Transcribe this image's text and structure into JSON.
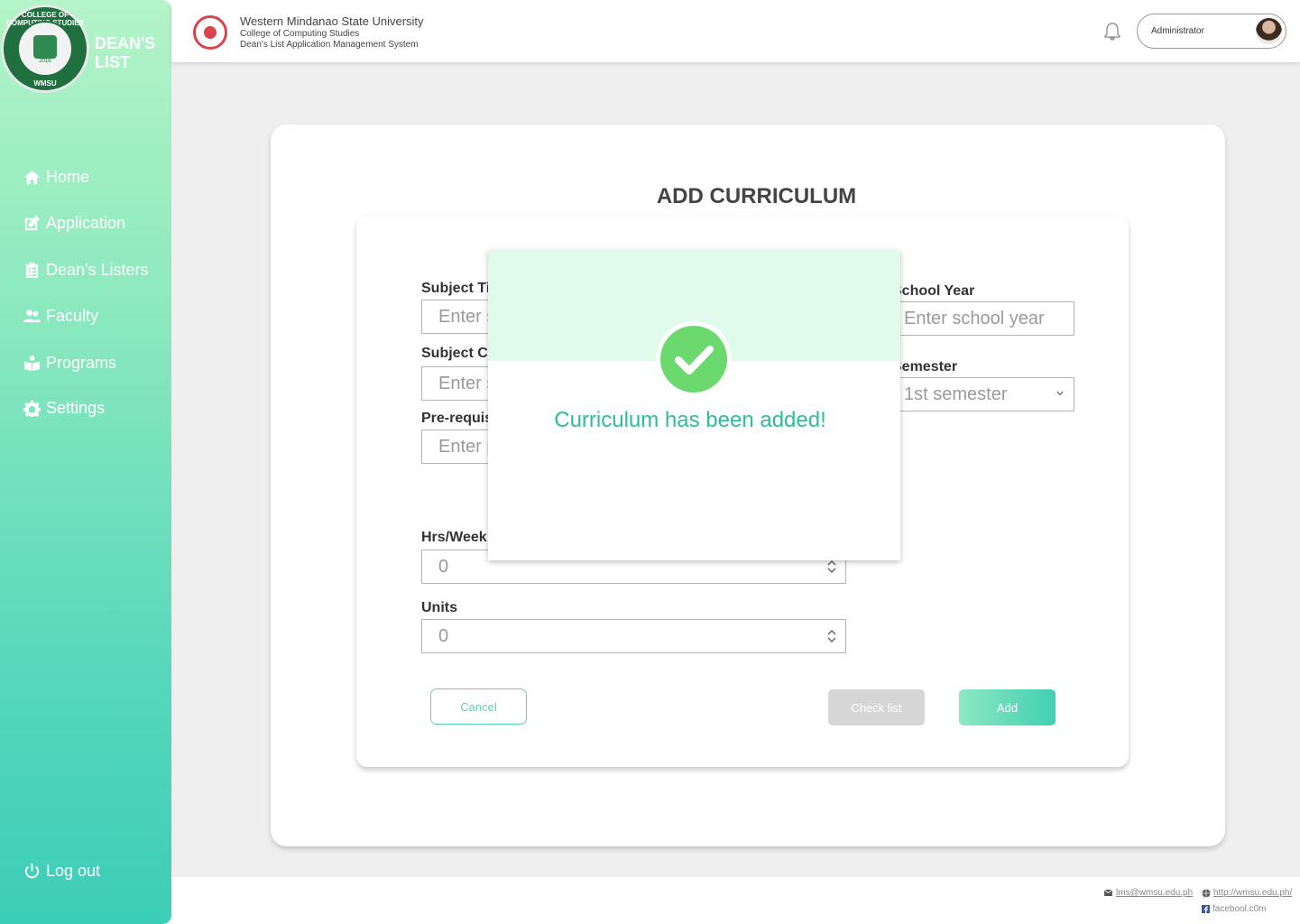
{
  "sidebar": {
    "seal": {
      "ring_text": "COLLEGE OF COMPUTING STUDIES",
      "year": "2016",
      "abbr": "WMSU"
    },
    "brand_line1": "DEAN'S",
    "brand_line2": "LIST",
    "items": [
      {
        "label": "Home",
        "icon": "home-icon"
      },
      {
        "label": "Application",
        "icon": "edit-icon"
      },
      {
        "label": "Dean's Listers",
        "icon": "clipboard-list-icon"
      },
      {
        "label": "Faculty",
        "icon": "users-icon"
      },
      {
        "label": "Programs",
        "icon": "reader-icon"
      },
      {
        "label": "Settings",
        "icon": "gear-icon"
      }
    ],
    "logout": {
      "label": "Log out",
      "icon": "power-icon"
    }
  },
  "header": {
    "university": "Western Mindanao State University",
    "college": "College of Computing Studies",
    "system": "Dean's List Application Management System",
    "user_role": "Administrator"
  },
  "page": {
    "title": "ADD CURRICULUM"
  },
  "form": {
    "subject_title": {
      "label": "Subject Title",
      "placeholder": "Enter subject title"
    },
    "subject_code": {
      "label": "Subject Code",
      "placeholder": "Enter subject code"
    },
    "prerequisite": {
      "label": "Pre-requisite",
      "placeholder": "Enter pre-requisite"
    },
    "hrs_week": {
      "label": "Hrs/Week",
      "value": "0"
    },
    "units": {
      "label": "Units",
      "value": "0"
    },
    "school_year": {
      "label": "School Year",
      "placeholder": "Enter school year"
    },
    "semester": {
      "label": "Semester",
      "value": "1st semester"
    }
  },
  "buttons": {
    "cancel": "Cancel",
    "check_list": "Check list",
    "add": "Add"
  },
  "modal": {
    "message": "Curriculum has been added!"
  },
  "footer": {
    "email": "lms@wmsu.edu.ph",
    "website": "http://wmsu.edu.ph/",
    "facebook": "facebool.c0m"
  },
  "colors": {
    "accent": "#42cfb3",
    "success": "#6cd96e",
    "modal_header": "#e0fbec"
  }
}
